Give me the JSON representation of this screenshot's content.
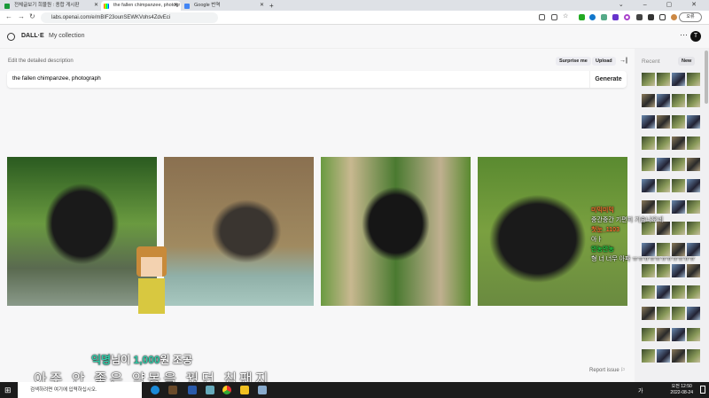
{
  "browser": {
    "tabs": [
      {
        "label": "전체글보기 희물원 : 종합 게시판"
      },
      {
        "label": "the fallen chimpanzee, photogr"
      },
      {
        "label": "Google 번역"
      }
    ],
    "new_tab": "+",
    "url": "labs.openai.com/e/mBIF23ounSEWKVohs4ZdvEci",
    "profile_label": "오류"
  },
  "app": {
    "brand": "DALL·E",
    "collection": "My collection",
    "more": "···",
    "avatar_initial": "T"
  },
  "editor": {
    "label": "Edit the detailed description",
    "surprise": "Surprise me",
    "upload": "Upload",
    "collapse": "→|",
    "prompt_value": "the fallen chimpanzee, photograph",
    "generate": "Generate",
    "report": "Report issue ⚐"
  },
  "images": [
    {
      "alt": "chimpanzee sitting with hand on head"
    },
    {
      "alt": "chimpanzee leaning on rock"
    },
    {
      "alt": "chimpanzee on wooden stump"
    },
    {
      "alt": "chimpanzee lying on grass"
    }
  ],
  "sidebar": {
    "recent": "Recent",
    "new": "New"
  },
  "stream_overlay": {
    "donation_name": "익명",
    "donation_mid": "님이 ",
    "donation_amount": "1,000",
    "donation_end": "원 조공",
    "donation_msg": "아주 안 좋은 약몽을 꿨던 침팬지",
    "chat": [
      {
        "user": "미믹미믹",
        "msg": "중간중간 기편치 기술나오네"
      },
      {
        "user": "첫눈_1103",
        "msg": "아ㅏ"
      },
      {
        "user": "안농안농",
        "msg": "형 너 너무 아파 ㅠㅠㅠㅠㅠㅠㅠㅠㅠㅠㅠ"
      }
    ]
  },
  "taskbar": {
    "search_placeholder": "검색하려면 여기에 입력하십시오.",
    "time": "오전 12:50",
    "date": "2022-08-24",
    "ime": "가"
  }
}
